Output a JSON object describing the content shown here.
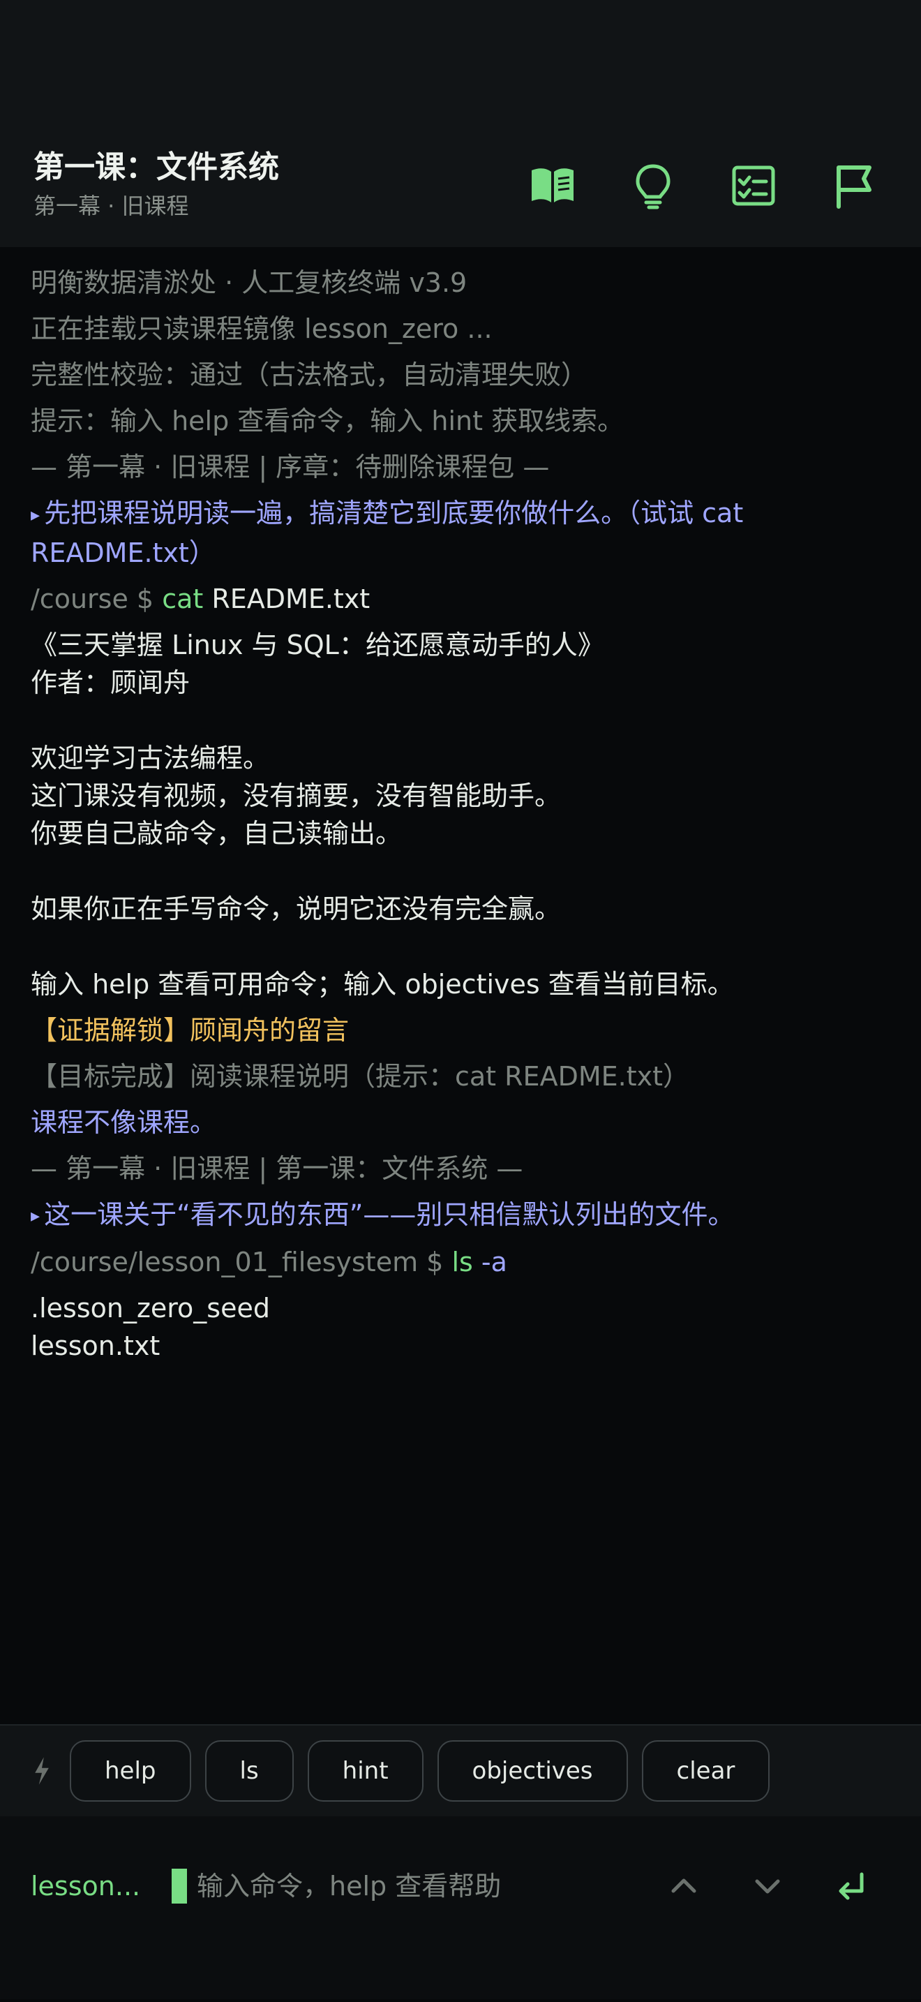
{
  "header": {
    "title": "第一课：文件系统",
    "subtitle": "第一幕 · 旧课程",
    "icons": [
      "book-icon",
      "lightbulb-icon",
      "checklist-icon",
      "flag-icon"
    ]
  },
  "terminal": {
    "banner": [
      "明衡数据清淤处 · 人工复核终端 v3.9",
      "正在挂载只读课程镜像 lesson_zero ...",
      "完整性校验：通过（古法格式，自动清理失败）",
      "提示：输入 help 查看命令，输入 hint 获取线索。"
    ],
    "section1": "— 第一幕 · 旧课程 | 序章：待删除课程包 —",
    "objective1": "先把课程说明读一遍，搞清楚它到底要你做什么。（试试 cat README.txt）",
    "cmd1": {
      "path": "/course $",
      "name": "cat",
      "arg": "README.txt"
    },
    "readme": "《三天掌握 Linux 与 SQL：给还愿意动手的人》\n作者：顾闻舟\n\n欢迎学习古法编程。\n这门课没有视频，没有摘要，没有智能助手。\n你要自己敲命令，自己读输出。\n\n如果你正在手写命令，说明它还没有完全赢。\n\n输入 help 查看可用命令；输入 objectives 查看当前目标。",
    "evidence": "【证据解锁】顾闻舟的留言",
    "goal_done": "【目标完成】阅读课程说明（提示：cat README.txt）",
    "story": "课程不像课程。",
    "section2": "— 第一幕 · 旧课程 | 第一课：文件系统 —",
    "objective2": "这一课关于“看不见的东西”——别只相信默认列出的文件。",
    "cmd2": {
      "path": "/course/lesson_01_filesystem $",
      "name": "ls",
      "arg": "-a"
    },
    "ls_output": ".lesson_zero_seed\nlesson.txt"
  },
  "quickbar": {
    "chips": [
      "help",
      "ls",
      "hint",
      "objectives",
      "clear"
    ]
  },
  "input": {
    "cwd": "lesson...",
    "placeholder": "输入命令，help 查看帮助"
  },
  "colors": {
    "background": "#07090b",
    "accent_green": "#79dd85",
    "objective_blue": "#9fa6ff",
    "evidence_gold": "#f2c25e",
    "muted_gray": "#7e8580"
  }
}
